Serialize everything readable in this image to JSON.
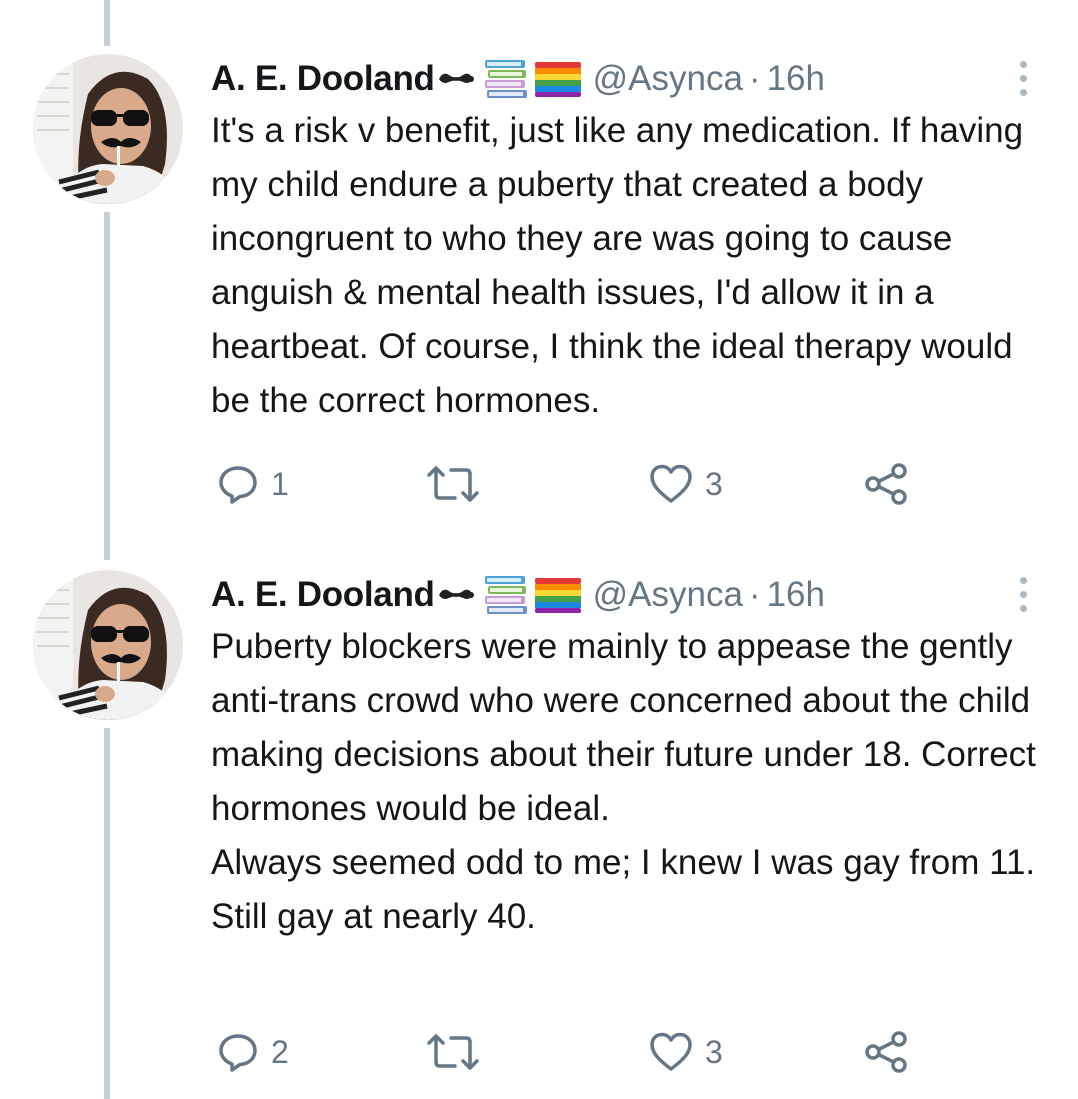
{
  "tweets": [
    {
      "author_name": "A. E. Dooland",
      "handle": "@Asynca",
      "separator": "·",
      "time": "16h",
      "text": "It's a risk v benefit, just like any medication. If having my child endure a puberty that created a body incongruent to who they are was going to cause anguish & mental health issues, I'd allow it in a heartbeat. Of course, I think the ideal therapy would be the correct hormones.",
      "reply_count": "1",
      "retweet_count": "",
      "like_count": "3"
    },
    {
      "author_name": "A. E. Dooland",
      "handle": "@Asynca",
      "separator": "·",
      "time": "16h",
      "text": "Puberty blockers were mainly to appease the gently anti-trans crowd who were concerned about the child making decisions about their future under 18. Correct hormones would be ideal.\nAlways seemed odd to me; I knew I was gay from 11. Still gay at nearly 40.",
      "reply_count": "2",
      "retweet_count": "",
      "like_count": "3"
    }
  ],
  "icons": {
    "name_emoji": "mustache-emoji",
    "badge_1": "books-emoji",
    "badge_2": "rainbow-flag-emoji",
    "more": "more-vertical-icon",
    "reply": "reply-icon",
    "retweet": "retweet-icon",
    "like": "heart-icon",
    "share": "share-icon"
  },
  "colors": {
    "text": "#14171a",
    "secondary": "#657786",
    "icon": "#657786",
    "thread_line": "#c4cfd6"
  }
}
